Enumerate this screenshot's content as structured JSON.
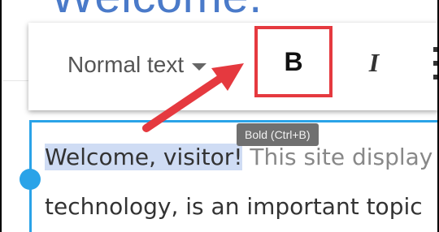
{
  "page": {
    "heading": "Welcome."
  },
  "toolbar": {
    "text_style": "Normal text",
    "bold_glyph": "B",
    "italic_glyph": "I"
  },
  "tooltip": {
    "text": "Bold (Ctrl+B)"
  },
  "editor": {
    "line1_selected": "Welcome, visitor!",
    "line1_rest": " This site display",
    "line2": "technology, is an important topic"
  },
  "colors": {
    "highlight_border": "#e5393f",
    "editor_focus": "#2aa3e8",
    "selection": "#cfdcf4"
  }
}
